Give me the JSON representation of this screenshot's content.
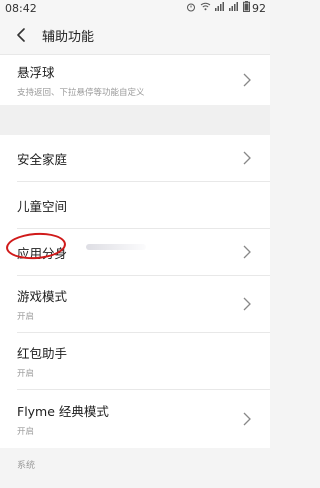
{
  "status_bar": {
    "time": "08:42",
    "battery_level": "92",
    "icons": [
      "alarm-icon",
      "wifi-icon",
      "signal-icon",
      "signal-icon",
      "battery-icon"
    ]
  },
  "header": {
    "title": "辅助功能"
  },
  "items": {
    "floating_ball": {
      "title": "悬浮球",
      "subtitle": "支持返回、下拉悬停等功能自定义"
    },
    "security_family": {
      "title": "安全家庭"
    },
    "kids_space": {
      "title": "儿童空间"
    },
    "app_clone": {
      "title": "应用分身"
    },
    "game_mode": {
      "title": "游戏模式",
      "subtitle": "开启"
    },
    "red_packet": {
      "title": "红包助手",
      "subtitle": "开启"
    },
    "flyme_classic": {
      "title": "Flyme 经典模式",
      "subtitle": "开启"
    }
  },
  "footer": {
    "section_label": "系统"
  },
  "colors": {
    "annotation_circle": "#d01a1a"
  }
}
